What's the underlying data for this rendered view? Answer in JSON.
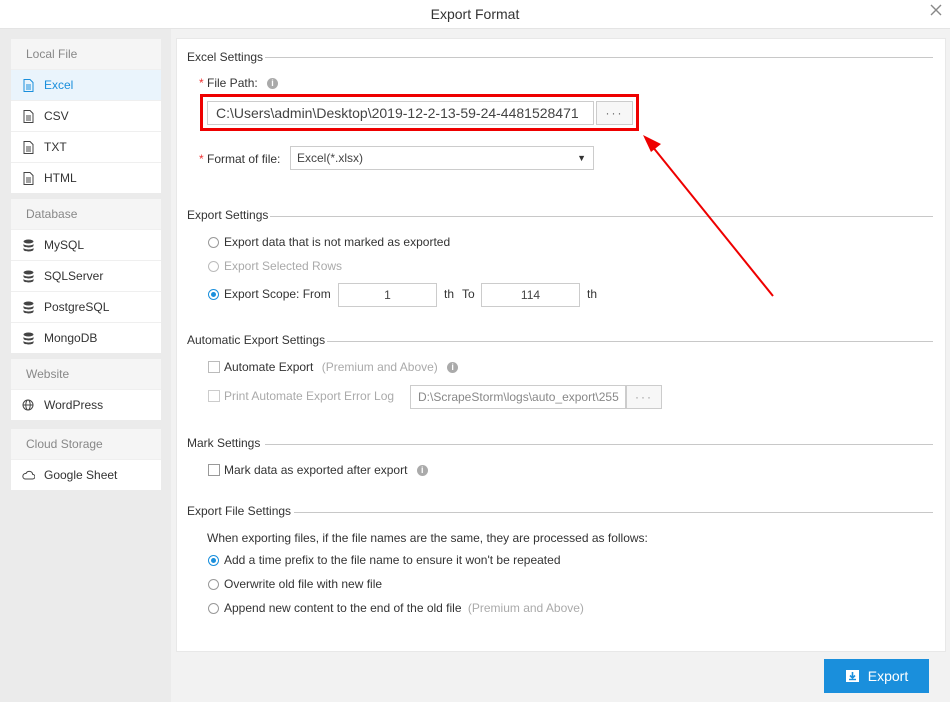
{
  "window": {
    "title": "Export Format",
    "close_icon": "close-icon"
  },
  "sidebar": {
    "groups": [
      {
        "title": "Local File",
        "items": [
          {
            "label": "Excel",
            "icon": "file-icon",
            "active": true
          },
          {
            "label": "CSV",
            "icon": "file-icon"
          },
          {
            "label": "TXT",
            "icon": "file-icon"
          },
          {
            "label": "HTML",
            "icon": "file-icon"
          }
        ]
      },
      {
        "title": "Database",
        "items": [
          {
            "label": "MySQL",
            "icon": "database-icon"
          },
          {
            "label": "SQLServer",
            "icon": "database-icon"
          },
          {
            "label": "PostgreSQL",
            "icon": "database-icon"
          },
          {
            "label": "MongoDB",
            "icon": "database-icon"
          }
        ]
      },
      {
        "title": "Website",
        "items": [
          {
            "label": "WordPress",
            "icon": "globe-icon"
          }
        ]
      },
      {
        "title": "Cloud Storage",
        "items": [
          {
            "label": "Google Sheet",
            "icon": "cloud-icon"
          }
        ]
      }
    ]
  },
  "excel_settings": {
    "title": "Excel Settings",
    "file_path_label": "File Path:",
    "file_path_value": "C:\\Users\\admin\\Desktop\\2019-12-2-13-59-24-4481528471",
    "browse_label": "···",
    "format_label": "Format of file:",
    "format_value": "Excel(*.xlsx)"
  },
  "export_settings": {
    "title": "Export Settings",
    "opt_unmarked": "Export data that is not marked as exported",
    "opt_selected": "Export Selected Rows",
    "opt_scope": "Export Scope: From",
    "from_value": "1",
    "th1": "th",
    "to_label": "To",
    "to_value": "114",
    "th2": "th"
  },
  "auto_export": {
    "title": "Automatic Export Settings",
    "automate_label": "Automate Export",
    "premium_note": "(Premium and Above)",
    "error_log_label": "Print Automate Export Error Log",
    "error_log_path": "D:\\ScrapeStorm\\logs\\auto_export\\255",
    "browse_label": "···"
  },
  "mark_settings": {
    "title": "Mark Settings",
    "mark_label": "Mark data as exported after export"
  },
  "file_settings": {
    "title": "Export File Settings",
    "description": "When exporting files, if the file names are the same, they are processed as follows:",
    "opt_prefix": "Add a time prefix to the file name to ensure it won't be repeated",
    "opt_overwrite": "Overwrite old file with new file",
    "opt_append": "Append new content to the end of the old file",
    "append_note": "(Premium and Above)"
  },
  "footer": {
    "export_label": "Export"
  },
  "colors": {
    "accent": "#1a8fdc",
    "annotation": "#e00000"
  }
}
